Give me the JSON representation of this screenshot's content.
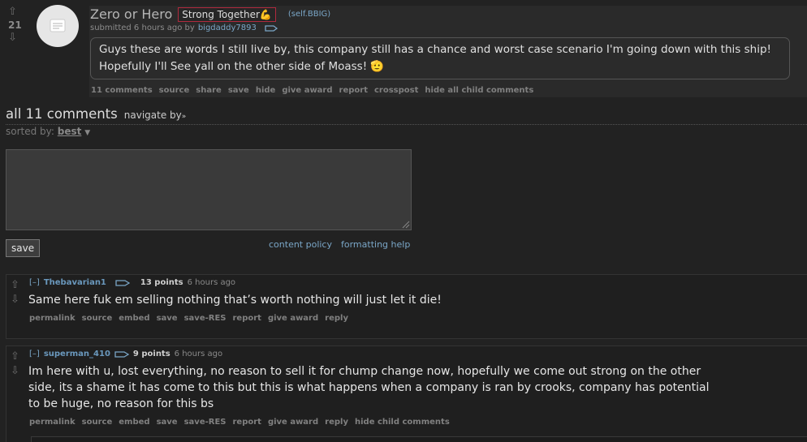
{
  "post": {
    "score": "21",
    "title": "Zero or Hero",
    "flair": "Strong Together💪",
    "domain": "(self.BBIG)",
    "tagline_prefix": "submitted 6 hours ago by",
    "author": "bigdaddy7893",
    "selftext": "Guys these are words I still live by, this company still has a chance and worst case scenario I'm going down with this ship! Hopefully I'll See yall on the other side of Moass! 🫡",
    "buttons": [
      "11 comments",
      "source",
      "share",
      "save",
      "hide",
      "give award",
      "report",
      "crosspost",
      "hide all child comments"
    ]
  },
  "comments_area": {
    "header": "all 11 comments",
    "navigate_label": "navigate by",
    "sorted_label": "sorted by:",
    "sorted_value": "best",
    "save_label": "save",
    "content_policy": "content policy",
    "formatting_help": "formatting help"
  },
  "comments": [
    {
      "expand": "[–]",
      "author": "Thebavarian1",
      "points": "13 points",
      "time": "6 hours ago",
      "body": "Same here fuk em selling nothing that’s worth nothing will just let it die!",
      "buttons": [
        "permalink",
        "source",
        "embed",
        "save",
        "save-RES",
        "report",
        "give award",
        "reply"
      ]
    },
    {
      "expand": "[–]",
      "author": "superman_410",
      "points": "9 points",
      "time": "6 hours ago",
      "body": "Im here with u, lost everything, no reason to sell it for chump change now, hopefully we come out strong on the other side, its a shame it has come to this but this is what happens when a company is ran by crooks, company has potential to be huge, no reason for this bs",
      "buttons": [
        "permalink",
        "source",
        "embed",
        "save",
        "save-RES",
        "report",
        "give award",
        "reply",
        "hide child comments"
      ]
    }
  ]
}
